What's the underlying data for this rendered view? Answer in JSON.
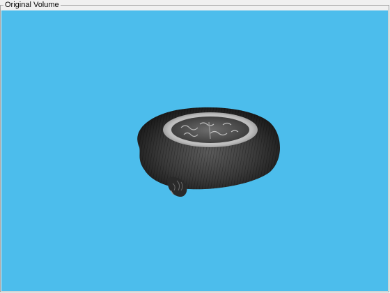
{
  "panel": {
    "title": "Original Volume"
  },
  "viewport": {
    "background_color": "#4cbdec",
    "content": "volume-render"
  },
  "colors": {
    "panel_bg": "#f0f0f0",
    "border": "#a0a0a0",
    "volume_dark": "#1c1c1c",
    "volume_light": "#cfcfcf"
  }
}
